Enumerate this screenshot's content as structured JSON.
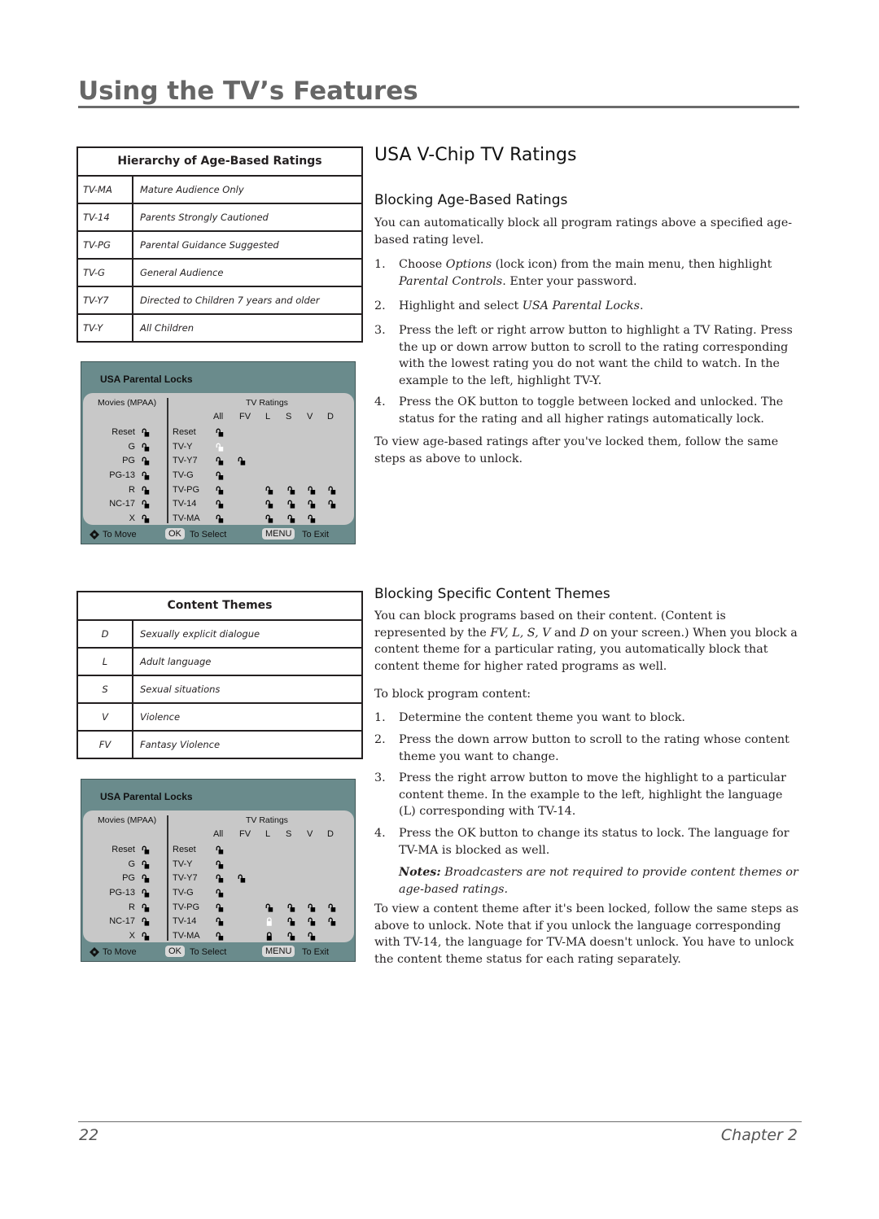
{
  "header": {
    "title": "Using the TV’s Features"
  },
  "age_table": {
    "title": "Hierarchy of Age-Based Ratings",
    "rows": [
      {
        "code": "TV-MA",
        "desc": "Mature Audience Only"
      },
      {
        "code": "TV-14",
        "desc": "Parents Strongly Cautioned"
      },
      {
        "code": "TV-PG",
        "desc": "Parental Guidance Suggested"
      },
      {
        "code": "TV-G",
        "desc": "General Audience"
      },
      {
        "code": "TV-Y7",
        "desc": "Directed to Children 7 years and older"
      },
      {
        "code": "TV-Y",
        "desc": "All Children"
      }
    ]
  },
  "content_table": {
    "title": "Content Themes",
    "rows": [
      {
        "code": "D",
        "desc": "Sexually explicit dialogue"
      },
      {
        "code": "L",
        "desc": "Adult language"
      },
      {
        "code": "S",
        "desc": "Sexual situations"
      },
      {
        "code": "V",
        "desc": "Violence"
      },
      {
        "code": "FV",
        "desc": "Fantasy Violence"
      }
    ]
  },
  "panels": [
    {
      "title": "USA Parental Locks",
      "movies_header": "Movies (MPAA)",
      "tv_header": "TV Ratings",
      "tv_columns": [
        "All",
        "FV",
        "L",
        "S",
        "V",
        "D"
      ],
      "movie_rows": [
        {
          "label": "Reset",
          "lock": "unlocked"
        },
        {
          "label": "G",
          "lock": "unlocked"
        },
        {
          "label": "PG",
          "lock": "unlocked"
        },
        {
          "label": "PG-13",
          "lock": "unlocked"
        },
        {
          "label": "R",
          "lock": "unlocked"
        },
        {
          "label": "NC-17",
          "lock": "unlocked"
        },
        {
          "label": "X",
          "lock": "unlocked"
        }
      ],
      "tv_rows": [
        {
          "label": "Reset",
          "cells": [
            "unlocked",
            null,
            null,
            null,
            null,
            null
          ]
        },
        {
          "label": "TV-Y",
          "cells": [
            "unlocked-highlight",
            null,
            null,
            null,
            null,
            null
          ]
        },
        {
          "label": "TV-Y7",
          "cells": [
            "unlocked",
            "unlocked",
            null,
            null,
            null,
            null
          ]
        },
        {
          "label": "TV-G",
          "cells": [
            "unlocked",
            null,
            null,
            null,
            null,
            null
          ]
        },
        {
          "label": "TV-PG",
          "cells": [
            "unlocked",
            null,
            "unlocked",
            "unlocked",
            "unlocked",
            "unlocked"
          ]
        },
        {
          "label": "TV-14",
          "cells": [
            "unlocked",
            null,
            "unlocked",
            "unlocked",
            "unlocked",
            "unlocked"
          ]
        },
        {
          "label": "TV-MA",
          "cells": [
            "unlocked",
            null,
            "unlocked",
            "unlocked",
            "unlocked",
            null
          ]
        }
      ],
      "footer": {
        "move": "To Move",
        "ok_key": "OK",
        "select": "To Select",
        "menu_key": "MENU",
        "exit": "To Exit"
      }
    },
    {
      "title": "USA Parental Locks",
      "movies_header": "Movies (MPAA)",
      "tv_header": "TV Ratings",
      "tv_columns": [
        "All",
        "FV",
        "L",
        "S",
        "V",
        "D"
      ],
      "movie_rows": [
        {
          "label": "Reset",
          "lock": "unlocked"
        },
        {
          "label": "G",
          "lock": "unlocked"
        },
        {
          "label": "PG",
          "lock": "unlocked"
        },
        {
          "label": "PG-13",
          "lock": "unlocked"
        },
        {
          "label": "R",
          "lock": "unlocked"
        },
        {
          "label": "NC-17",
          "lock": "unlocked"
        },
        {
          "label": "X",
          "lock": "unlocked"
        }
      ],
      "tv_rows": [
        {
          "label": "Reset",
          "cells": [
            "unlocked",
            null,
            null,
            null,
            null,
            null
          ]
        },
        {
          "label": "TV-Y",
          "cells": [
            "unlocked",
            null,
            null,
            null,
            null,
            null
          ]
        },
        {
          "label": "TV-Y7",
          "cells": [
            "unlocked",
            "unlocked",
            null,
            null,
            null,
            null
          ]
        },
        {
          "label": "TV-G",
          "cells": [
            "unlocked",
            null,
            null,
            null,
            null,
            null
          ]
        },
        {
          "label": "TV-PG",
          "cells": [
            "unlocked",
            null,
            "unlocked",
            "unlocked",
            "unlocked",
            "unlocked"
          ]
        },
        {
          "label": "TV-14",
          "cells": [
            "unlocked",
            null,
            "locked-highlight",
            "unlocked",
            "unlocked",
            "unlocked"
          ]
        },
        {
          "label": "TV-MA",
          "cells": [
            "unlocked",
            null,
            "locked",
            "unlocked",
            "unlocked",
            null
          ]
        }
      ],
      "footer": {
        "move": "To Move",
        "ok_key": "OK",
        "select": "To Select",
        "menu_key": "MENU",
        "exit": "To Exit"
      }
    }
  ],
  "section": {
    "title": "USA V-Chip TV Ratings",
    "age": {
      "heading": "Blocking Age-Based Ratings",
      "intro": "You can automatically block all program ratings above a specified age-based rating level.",
      "steps": [
        {
          "num": "1.",
          "html": "Choose <i>Options</i> (lock icon) from the main menu, then highlight <i>Parental Controls</i>. Enter your password."
        },
        {
          "num": "2.",
          "html": "Highlight and select <i>USA Parental Locks</i>."
        },
        {
          "num": "3.",
          "html": "Press the left or right arrow button to highlight a TV Rating. Press the up or down arrow button to scroll to the rating corresponding with the lowest rating you do not want the child to watch. In the example to the left, highlight TV-Y."
        },
        {
          "num": "4.",
          "html": "Press the OK button to toggle between locked and unlocked. The status for the rating and all higher ratings automatically lock."
        }
      ],
      "outro": "To view age-based ratings after you've locked them, follow the same steps as above to unlock."
    },
    "content": {
      "heading": "Blocking Specific Content Themes",
      "intro_html": "You can block programs based on their content. (Content is represented by the <i>FV, L, S, V</i> and <i>D</i> on your screen.) When you block a content theme for a particular rating, you automatically block that content theme for higher rated programs as well.",
      "lead": "To block program content:",
      "steps": [
        {
          "num": "1.",
          "html": "Determine the content theme you want to block."
        },
        {
          "num": "2.",
          "html": "Press the down arrow button to scroll to the rating whose content theme you want to change."
        },
        {
          "num": "3.",
          "html": "Press the right arrow button to move the highlight to a particular content theme. In the example to the left, highlight the language (L) corresponding with TV-14."
        },
        {
          "num": "4.",
          "html": "Press the OK button to change its status to lock. The language for TV-MA is blocked as well."
        }
      ],
      "note_label": "Notes:",
      "note_text": "Broadcasters are not required to provide content themes or age-based ratings.",
      "outro": "To view a content theme after it's been locked, follow the same steps as above to unlock. Note that if you unlock the language corresponding with TV-14, the language for TV-MA doesn't unlock. You have to unlock the content theme status for each rating separately."
    }
  },
  "footer": {
    "page_number": "22",
    "chapter": "Chapter 2"
  }
}
